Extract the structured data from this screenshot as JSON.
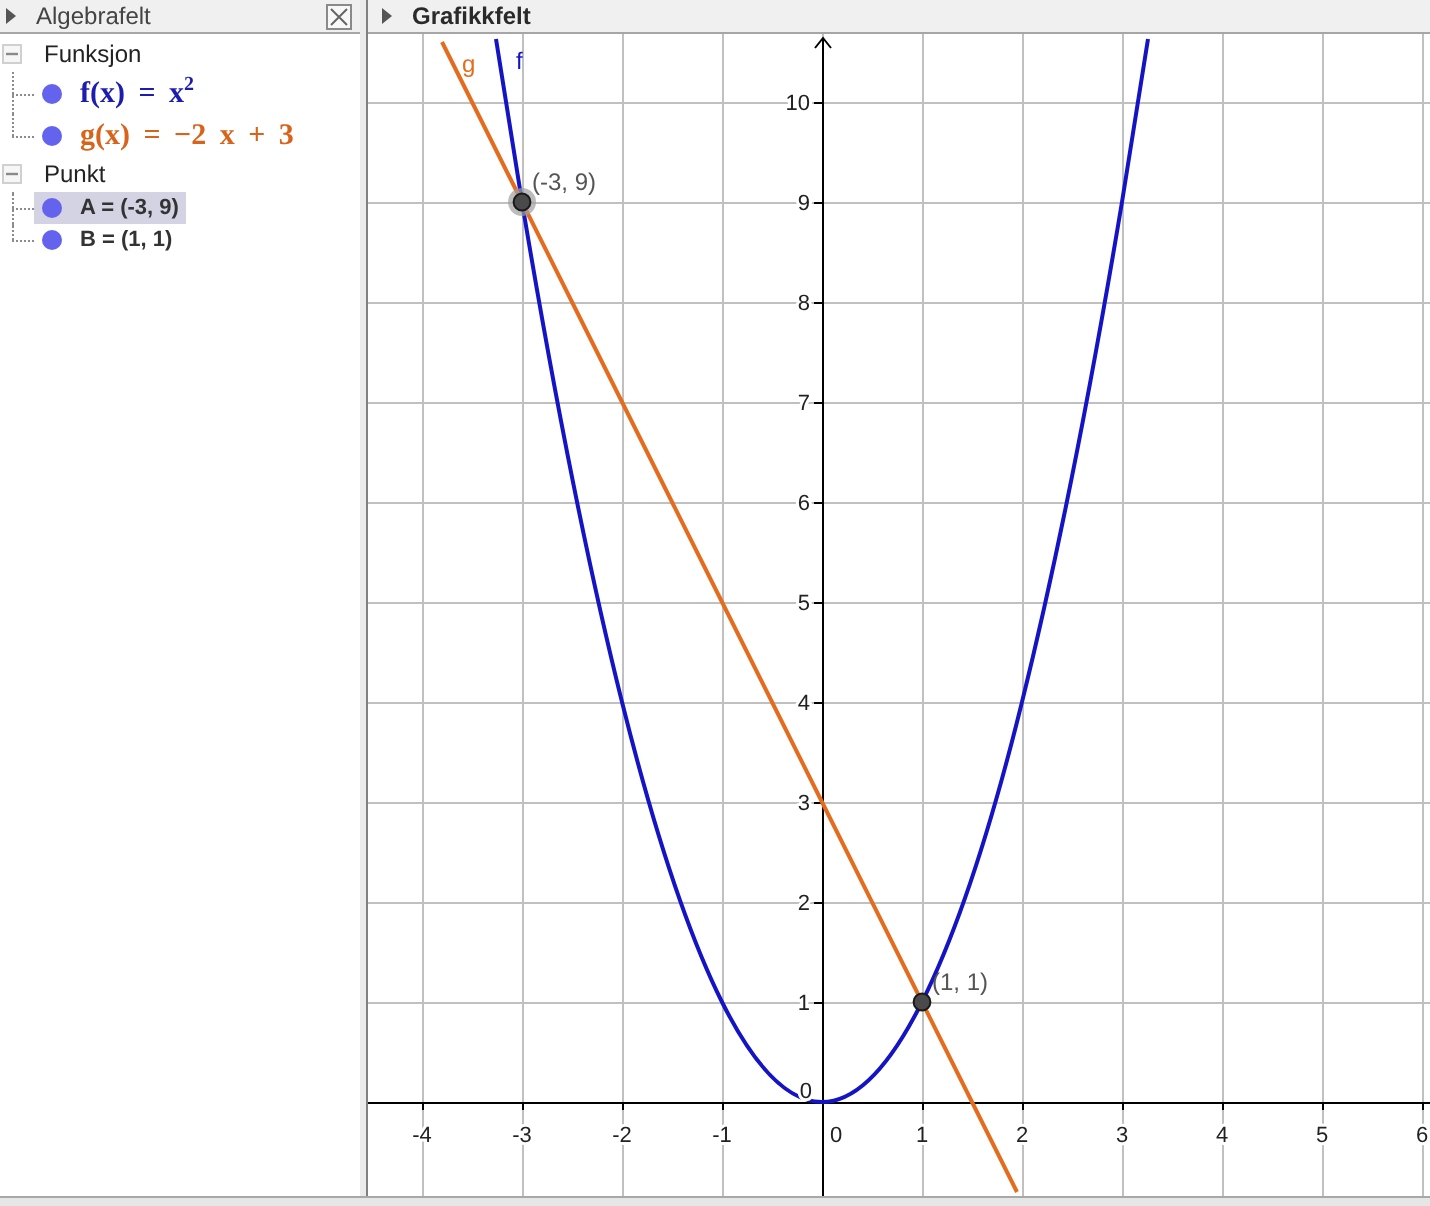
{
  "algebra_view": {
    "title": "Algebrafelt",
    "focused": false,
    "groups": [
      {
        "label": "Funksjon",
        "expanded": true,
        "items": [
          {
            "kind": "function",
            "text": "f(x) = x$^{2}$",
            "color": "#1c1cb0",
            "visible": true,
            "selected": false
          },
          {
            "kind": "function",
            "text": "g(x) = −2 x + 3",
            "color": "#d8641c",
            "visible": true,
            "selected": false
          }
        ]
      },
      {
        "label": "Punkt",
        "expanded": true,
        "items": [
          {
            "kind": "point",
            "text": "A = (-3, 9)",
            "visible": true,
            "selected": true
          },
          {
            "kind": "point",
            "text": "B = (1, 1)",
            "visible": true,
            "selected": false
          }
        ]
      }
    ]
  },
  "graphics_view": {
    "title": "Grafikkfelt",
    "focused": true,
    "chart_data": {
      "type": "line",
      "x": [
        -3.8,
        -3.26,
        -3,
        -2,
        -1,
        0,
        1,
        1.95,
        2,
        3,
        3.26
      ],
      "series": [
        {
          "name": "f",
          "color": "#1414c4",
          "values": [
            null,
            10.63,
            9,
            4,
            1,
            0,
            1,
            3.8,
            4,
            9,
            10.63
          ]
        },
        {
          "name": "g",
          "color": "#e46c1e",
          "values": [
            10.6,
            9.52,
            9,
            7,
            5,
            3,
            1,
            -0.9,
            null,
            null,
            null
          ]
        }
      ],
      "xlim": [
        -4.54,
        6.08
      ],
      "ylim": [
        -0.94,
        10.68
      ],
      "xticks": [
        -4,
        -3,
        -2,
        -1,
        0,
        1,
        2,
        3,
        4,
        5,
        6
      ],
      "yticks": [
        0,
        1,
        2,
        3,
        4,
        5,
        6,
        7,
        8,
        9,
        10
      ],
      "grid": true,
      "annotations": [
        {
          "x": -3,
          "y": 9,
          "text": "(-3, 9)"
        },
        {
          "x": 1,
          "y": 1,
          "text": "(1, 1)"
        }
      ]
    }
  }
}
